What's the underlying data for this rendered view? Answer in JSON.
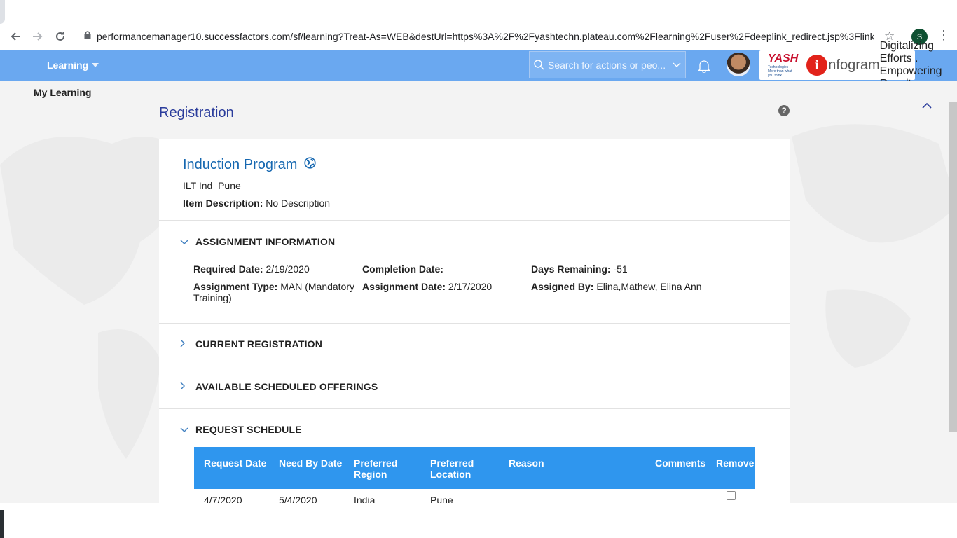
{
  "browser": {
    "url": "performancemanager10.successfactors.com/sf/learning?Treat-As=WEB&destUrl=https%3A%2F%2Fyashtechn.plateau.com%2Flearning%2Fuser%2Fdeeplink_redirect.jsp%3FlinkId...",
    "profile_initial": "S"
  },
  "header": {
    "module": "Learning",
    "search_placeholder": "Search for actions or peo...",
    "logo_yash": "YASH",
    "logo_yash_sub": "Technologies",
    "logo_yash_tagline": "More than what you think.",
    "logo_infogram": "nfogram",
    "logo_infogram_i": "i",
    "logo_infogram_tagline": "Digitalizing Efforts . Empowering Results"
  },
  "subnav": {
    "label": "My Learning"
  },
  "page": {
    "title": "Registration"
  },
  "item": {
    "title": "Induction Program",
    "code": "ILT Ind_Pune",
    "desc_label": "Item Description:",
    "desc_value": "No Description"
  },
  "assignment": {
    "heading": "ASSIGNMENT INFORMATION",
    "required_date_label": "Required Date:",
    "required_date": "2/19/2020",
    "completion_date_label": "Completion Date:",
    "completion_date": "",
    "days_remaining_label": "Days Remaining:",
    "days_remaining": "-51",
    "assignment_type_label": "Assignment Type:",
    "assignment_type": "MAN (Mandatory Training)",
    "assignment_date_label": "Assignment Date:",
    "assignment_date": "2/17/2020",
    "assigned_by_label": "Assigned By:",
    "assigned_by": "Elina,Mathew, Elina Ann"
  },
  "sections": {
    "current_registration": "CURRENT REGISTRATION",
    "available_offerings": "AVAILABLE SCHEDULED OFFERINGS",
    "request_schedule": "REQUEST SCHEDULE"
  },
  "request_table": {
    "columns": {
      "request_date": "Request Date",
      "need_by_date": "Need By Date",
      "preferred_region": "Preferred Region",
      "preferred_location": "Preferred Location",
      "reason": "Reason",
      "comments": "Comments",
      "remove": "Remove"
    },
    "rows": [
      {
        "request_date": "4/7/2020",
        "need_by_date": "5/4/2020",
        "preferred_region": "India",
        "preferred_location": "Pune",
        "reason": "",
        "comments": "",
        "remove": false
      }
    ]
  },
  "colors": {
    "header_blue": "#6aa8f0",
    "table_header": "#2f96ee",
    "title_blue": "#1567b0",
    "page_title": "#2b3d9c"
  }
}
